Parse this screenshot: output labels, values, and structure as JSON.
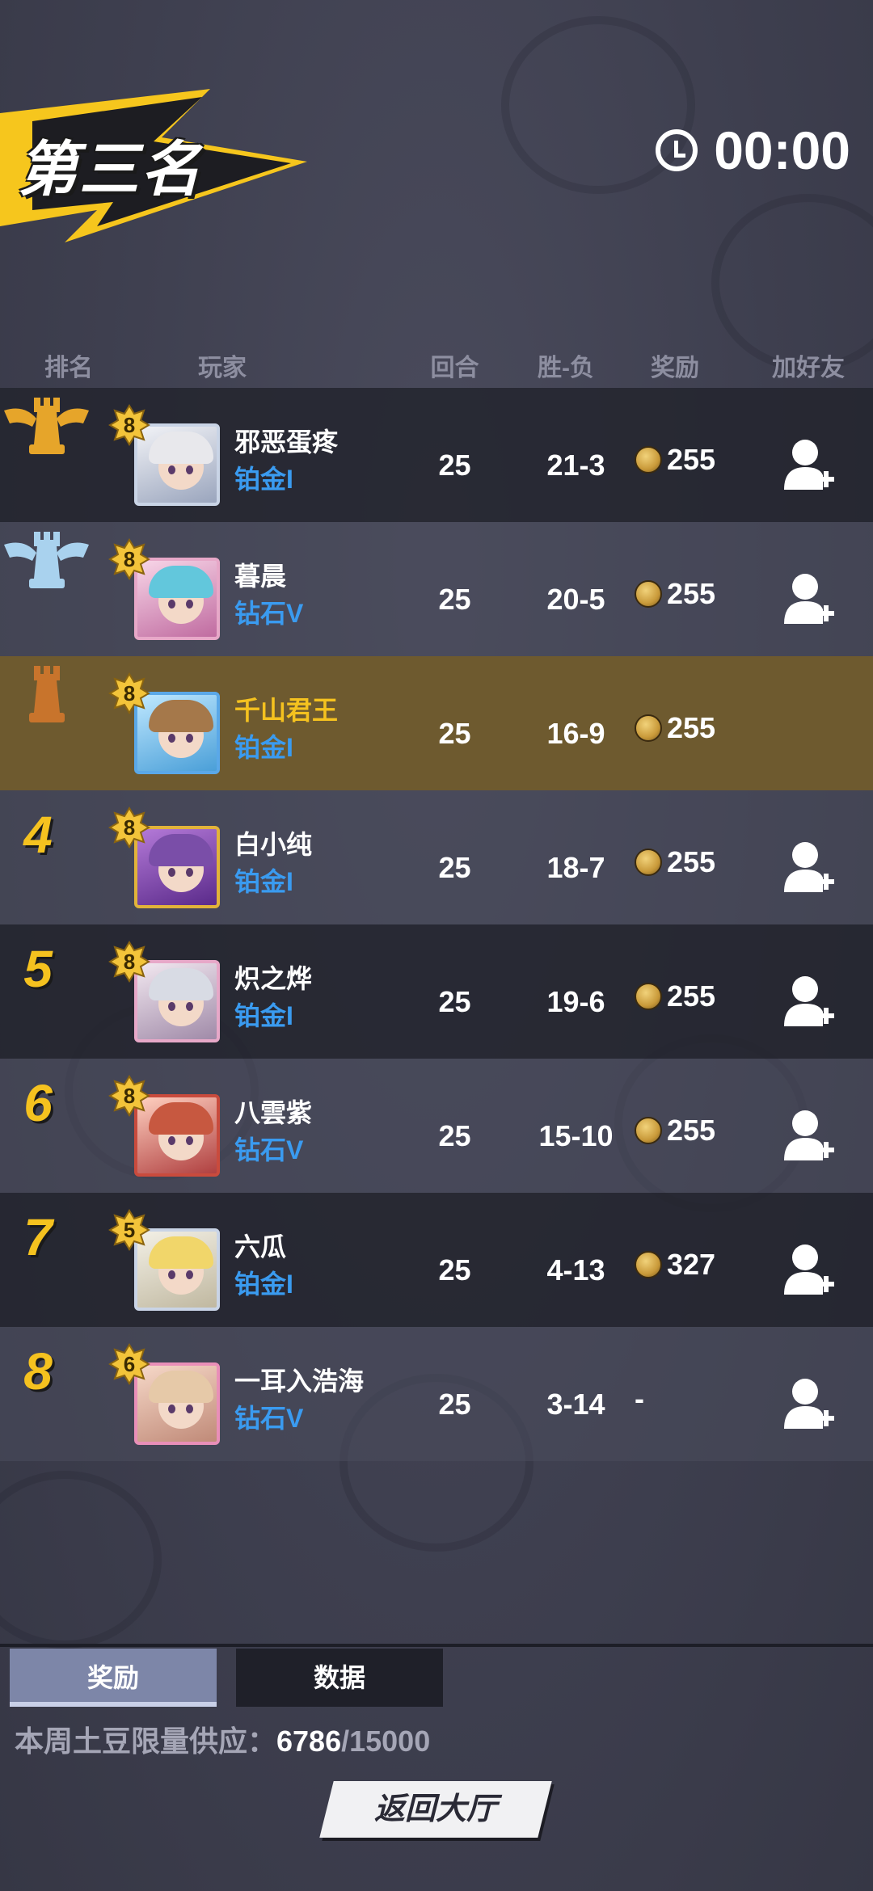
{
  "title": "第三名",
  "timer": "00:00",
  "headers": {
    "rank": "排名",
    "player": "玩家",
    "rounds": "回合",
    "win_loss": "胜-负",
    "reward": "奖励",
    "add_friend": "加好友"
  },
  "rows": [
    {
      "rank": "1",
      "trophy": "gold-rook-winged",
      "level": "8",
      "name": "邪恶蛋疼",
      "tier": "铂金I",
      "rounds": "25",
      "wl": "21-3",
      "reward": "255",
      "has_add": true
    },
    {
      "rank": "2",
      "trophy": "silver-rook-winged",
      "level": "8",
      "name": "暮晨",
      "tier": "钻石V",
      "rounds": "25",
      "wl": "20-5",
      "reward": "255",
      "has_add": true
    },
    {
      "rank": "3",
      "trophy": "bronze-rook",
      "level": "8",
      "name": "千山君王",
      "tier": "铂金I",
      "rounds": "25",
      "wl": "16-9",
      "reward": "255",
      "has_add": false,
      "self": true
    },
    {
      "rank": "4",
      "level": "8",
      "name": "白小纯",
      "tier": "铂金I",
      "rounds": "25",
      "wl": "18-7",
      "reward": "255",
      "has_add": true
    },
    {
      "rank": "5",
      "level": "8",
      "name": "炽之烨",
      "tier": "铂金I",
      "rounds": "25",
      "wl": "19-6",
      "reward": "255",
      "has_add": true
    },
    {
      "rank": "6",
      "level": "8",
      "name": "八雲紫",
      "tier": "钻石V",
      "rounds": "25",
      "wl": "15-10",
      "reward": "255",
      "has_add": true
    },
    {
      "rank": "7",
      "level": "5",
      "name": "六瓜",
      "tier": "铂金I",
      "rounds": "25",
      "wl": "4-13",
      "reward": "327",
      "has_add": true
    },
    {
      "rank": "8",
      "level": "6",
      "name": "一耳入浩海",
      "tier": "钻石V",
      "rounds": "25",
      "wl": "3-14",
      "reward": "-",
      "has_add": true
    }
  ],
  "tabs": {
    "reward": "奖励",
    "data": "数据"
  },
  "supply": {
    "label": "本周土豆限量供应：",
    "current": "6786",
    "max": "/15000"
  },
  "back_button": "返回大厅",
  "colors": {
    "gold": "#f5c21f",
    "tier_blue": "#3a9bf0",
    "self_row": "#6e5a2f"
  }
}
